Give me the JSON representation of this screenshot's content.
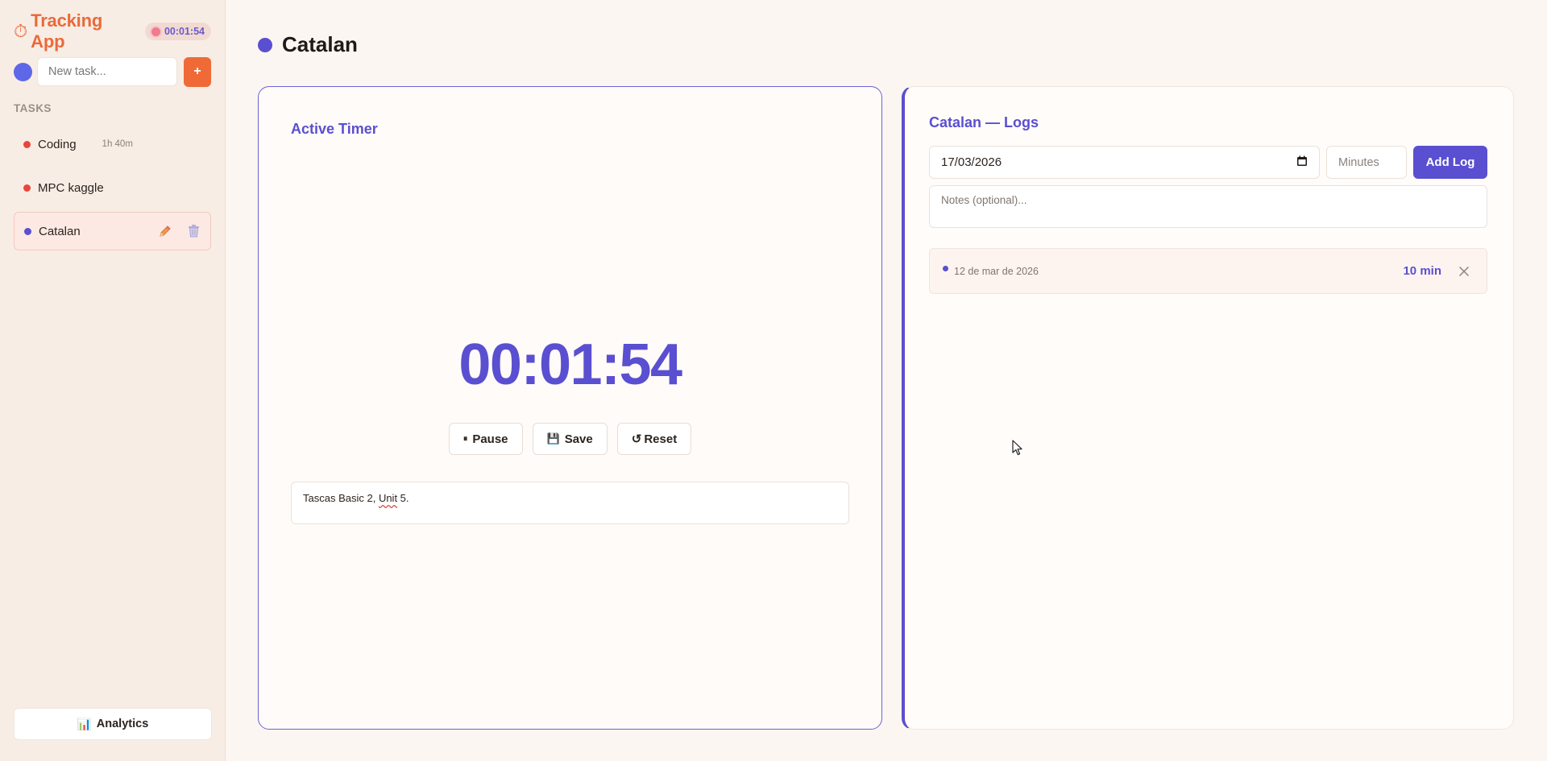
{
  "sidebar": {
    "brand": {
      "icon": "stopwatch-icon",
      "glyph": "⏱",
      "title": "Tracking App"
    },
    "running_badge": {
      "time": "00:01:54",
      "color": "#ef7b8c"
    },
    "new_task": {
      "placeholder": "New task...",
      "color": "#5d67e8",
      "add_label": "+"
    },
    "section_label": "TASKS",
    "tasks": [
      {
        "name": "Coding",
        "time": "1h 40m",
        "color": "#e8463c",
        "active": false
      },
      {
        "name": "MPC kaggle",
        "time": "",
        "color": "#e8463c",
        "active": false
      },
      {
        "name": "Catalan",
        "time": "",
        "color": "#5a4fd0",
        "active": true,
        "edit_icon": "pencil-icon",
        "delete_icon": "trash-icon"
      }
    ],
    "analytics": {
      "icon": "bar-chart-icon",
      "glyph": "📊",
      "label": "Analytics"
    }
  },
  "header": {
    "title": "Catalan",
    "color": "#5a4fd0"
  },
  "timer": {
    "heading": "Active Timer",
    "display": "00:01:54",
    "buttons": {
      "pause": {
        "glyph": "⏸",
        "label": "Pause"
      },
      "save": {
        "glyph": "💾",
        "label": "Save"
      },
      "reset": {
        "glyph": "↺",
        "label": "Reset"
      }
    },
    "note_prefix": "Tascas Basic 2, ",
    "note_unit": "Unit",
    "note_suffix": " 5."
  },
  "logs": {
    "heading": "Catalan — Logs",
    "date_value": "17/03/2026",
    "minutes_placeholder": "Minutes",
    "add_label": "Add Log",
    "notes_placeholder": "Notes (optional)...",
    "entries": [
      {
        "date": "12 de mar de 2026",
        "minutes": "10 min"
      }
    ]
  },
  "colors": {
    "accent": "#5a4fd0",
    "brand": "#ea6a3a",
    "danger": "#e8463c"
  }
}
